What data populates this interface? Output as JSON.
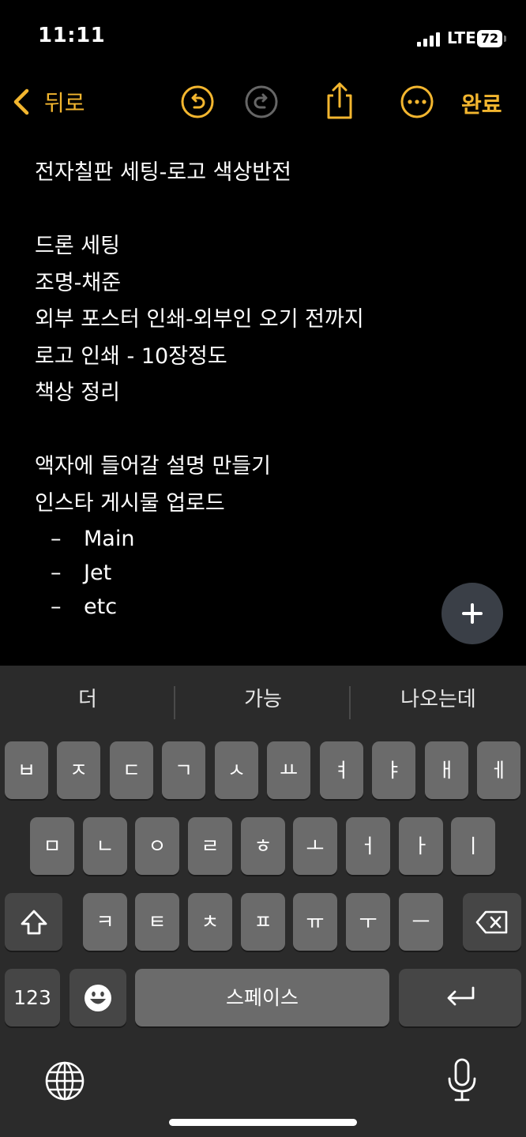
{
  "status": {
    "time": "11:11",
    "network": "LTE",
    "battery": "72"
  },
  "toolbar": {
    "back_label": "뒤로",
    "done_label": "완료"
  },
  "note": {
    "lines": [
      "전자칠판 세팅-로고 색상반전",
      "",
      "드론 세팅",
      "조명-채준",
      "외부 포스터 인쇄-외부인 오기 전까지",
      "로고 인쇄 - 10장정도",
      "책상 정리",
      "",
      "액자에 들어갈 설명 만들기",
      "인스타 게시물 업로드"
    ],
    "dash_items": [
      "Main",
      "Jet",
      "etc"
    ],
    "dash_symbol": "–"
  },
  "keyboard": {
    "suggestions": [
      "더",
      "가능",
      "나오는데"
    ],
    "row1": [
      "ㅂ",
      "ㅈ",
      "ㄷ",
      "ㄱ",
      "ㅅ",
      "ㅛ",
      "ㅕ",
      "ㅑ",
      "ㅐ",
      "ㅔ"
    ],
    "row2": [
      "ㅁ",
      "ㄴ",
      "ㅇ",
      "ㄹ",
      "ㅎ",
      "ㅗ",
      "ㅓ",
      "ㅏ",
      "ㅣ"
    ],
    "row3": [
      "ㅋ",
      "ㅌ",
      "ㅊ",
      "ㅍ",
      "ㅠ",
      "ㅜ",
      "ㅡ"
    ],
    "numbers_label": "123",
    "space_label": "스페이스"
  },
  "colors": {
    "accent": "#F3B62F",
    "background": "#000000",
    "keyboard": "#2B2B2B"
  },
  "icons": [
    "back-chevron-icon",
    "undo-icon",
    "redo-icon",
    "share-icon",
    "more-icon",
    "plus-icon",
    "shift-icon",
    "delete-icon",
    "emoji-icon",
    "return-icon",
    "globe-icon",
    "mic-icon"
  ]
}
